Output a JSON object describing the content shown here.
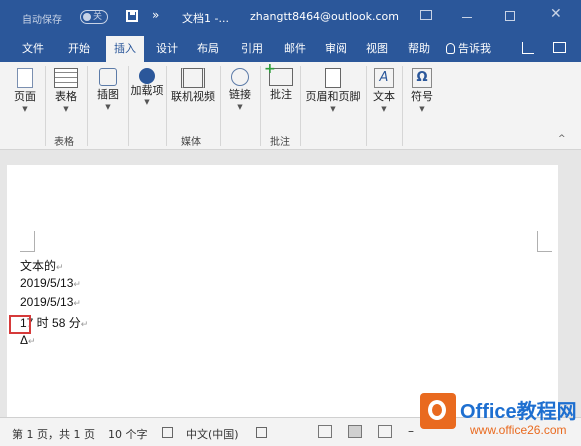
{
  "titlebar": {
    "autosave_label": "自动保存",
    "autosave_state": "关",
    "more": "»",
    "doc_title": "文档1  -...",
    "user": "zhangtt8464@outlook.com",
    "close": "✕"
  },
  "tabs": [
    {
      "label": "文件"
    },
    {
      "label": "开始"
    },
    {
      "label": "插入"
    },
    {
      "label": "设计"
    },
    {
      "label": "布局"
    },
    {
      "label": "引用"
    },
    {
      "label": "邮件"
    },
    {
      "label": "审阅"
    },
    {
      "label": "视图"
    },
    {
      "label": "帮助"
    }
  ],
  "tell_me": "告诉我",
  "ribbon": {
    "buttons": [
      {
        "label": "页面"
      },
      {
        "label": "表格"
      },
      {
        "label": "插图"
      },
      {
        "label": "加载项"
      },
      {
        "label": "联机视频"
      },
      {
        "label": "链接"
      },
      {
        "label": "批注"
      },
      {
        "label": "页眉和页脚"
      },
      {
        "label": "文本"
      },
      {
        "label": "符号"
      }
    ],
    "groups": [
      "表格",
      "媒体",
      "批注"
    ],
    "symbol_icon": "Ω",
    "text_icon": "A",
    "collapse": "^"
  },
  "document": {
    "lines": [
      "文本的",
      "2019/5/13",
      "2019/5/13",
      "17 时 58 分",
      "Δ"
    ],
    "para_mark": "↵"
  },
  "statusbar": {
    "page": "第 1 页，共 1 页",
    "words": "10 个字",
    "language": "中文(中国)",
    "zoom_minus": "–"
  },
  "watermark": {
    "title": "Office教程网",
    "url": "www.office26.com"
  }
}
